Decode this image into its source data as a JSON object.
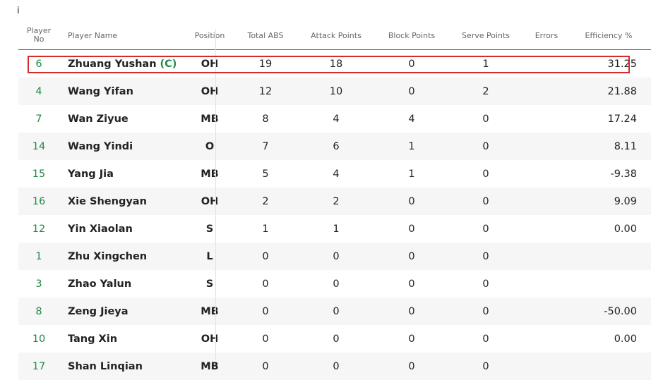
{
  "corner_text": "i",
  "columns": {
    "no": "Player\nNo",
    "name": "Player Name",
    "position": "Position",
    "total_abs": "Total ABS",
    "attack": "Attack Points",
    "block": "Block Points",
    "serve": "Serve Points",
    "errors": "Errors",
    "efficiency": "Efficiency %"
  },
  "rows": [
    {
      "no": "6",
      "name": "Zhuang Yushan",
      "captain": "(C)",
      "pos": "OH",
      "abs": "19",
      "att": "18",
      "blk": "0",
      "srv": "1",
      "err": "",
      "eff": "31.25"
    },
    {
      "no": "4",
      "name": "Wang Yifan",
      "captain": "",
      "pos": "OH",
      "abs": "12",
      "att": "10",
      "blk": "0",
      "srv": "2",
      "err": "",
      "eff": "21.88"
    },
    {
      "no": "7",
      "name": "Wan Ziyue",
      "captain": "",
      "pos": "MB",
      "abs": "8",
      "att": "4",
      "blk": "4",
      "srv": "0",
      "err": "",
      "eff": "17.24"
    },
    {
      "no": "14",
      "name": "Wang Yindi",
      "captain": "",
      "pos": "O",
      "abs": "7",
      "att": "6",
      "blk": "1",
      "srv": "0",
      "err": "",
      "eff": "8.11"
    },
    {
      "no": "15",
      "name": "Yang Jia",
      "captain": "",
      "pos": "MB",
      "abs": "5",
      "att": "4",
      "blk": "1",
      "srv": "0",
      "err": "",
      "eff": "-9.38"
    },
    {
      "no": "16",
      "name": "Xie Shengyan",
      "captain": "",
      "pos": "OH",
      "abs": "2",
      "att": "2",
      "blk": "0",
      "srv": "0",
      "err": "",
      "eff": "9.09"
    },
    {
      "no": "12",
      "name": "Yin Xiaolan",
      "captain": "",
      "pos": "S",
      "abs": "1",
      "att": "1",
      "blk": "0",
      "srv": "0",
      "err": "",
      "eff": "0.00"
    },
    {
      "no": "1",
      "name": "Zhu Xingchen",
      "captain": "",
      "pos": "L",
      "abs": "0",
      "att": "0",
      "blk": "0",
      "srv": "0",
      "err": "",
      "eff": ""
    },
    {
      "no": "3",
      "name": "Zhao Yalun",
      "captain": "",
      "pos": "S",
      "abs": "0",
      "att": "0",
      "blk": "0",
      "srv": "0",
      "err": "",
      "eff": ""
    },
    {
      "no": "8",
      "name": "Zeng Jieya",
      "captain": "",
      "pos": "MB",
      "abs": "0",
      "att": "0",
      "blk": "0",
      "srv": "0",
      "err": "",
      "eff": "-50.00"
    },
    {
      "no": "10",
      "name": "Tang Xin",
      "captain": "",
      "pos": "OH",
      "abs": "0",
      "att": "0",
      "blk": "0",
      "srv": "0",
      "err": "",
      "eff": "0.00"
    },
    {
      "no": "17",
      "name": "Shan Linqian",
      "captain": "",
      "pos": "MB",
      "abs": "0",
      "att": "0",
      "blk": "0",
      "srv": "0",
      "err": "",
      "eff": ""
    }
  ]
}
